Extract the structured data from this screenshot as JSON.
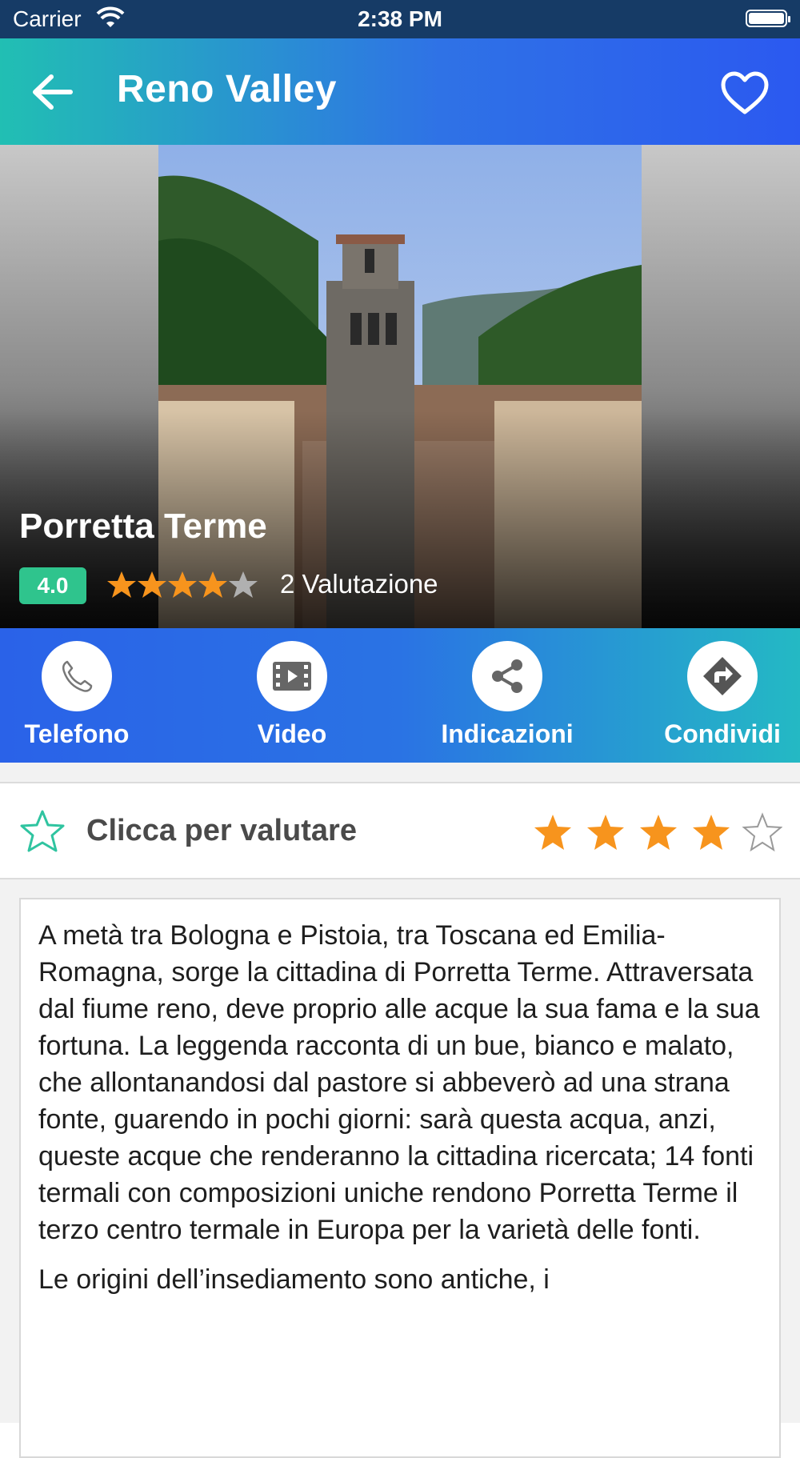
{
  "status_bar": {
    "carrier": "Carrier",
    "time": "2:38 PM"
  },
  "app_bar": {
    "title": "Reno Valley"
  },
  "place": {
    "name": "Porretta Terme",
    "rating_badge": "4.0",
    "rating_value": 4,
    "rating_max": 5,
    "ratings_count_text": "2 Valutazione"
  },
  "actions": [
    {
      "label": "Telefono",
      "icon": "phone-icon"
    },
    {
      "label": "Video",
      "icon": "video-icon"
    },
    {
      "label": "Indicazioni",
      "icon": "share-icon"
    },
    {
      "label": "Condividi",
      "icon": "directions-icon"
    }
  ],
  "rate_section": {
    "label": "Clicca per valutare",
    "user_rating": 4,
    "max": 5
  },
  "description": {
    "paragraphs": [
      "A metà tra Bologna e Pistoia, tra Toscana ed Emilia-Romagna, sorge la cittadina di Porretta Terme. Attraversata dal fiume reno, deve proprio alle acque la sua fama e la sua fortuna. La leggenda racconta di un bue, bianco e malato, che allontanandosi dal pastore si abbeverò ad una strana fonte, guarendo in pochi giorni: sarà questa acqua, anzi, queste acque che renderanno la cittadina ricercata; 14 fonti termali con composizioni uniche rendono Porretta Terme il terzo centro termale in Europa per la varietà delle fonti.",
      "Le origini dell’insediamento sono antiche, i"
    ]
  },
  "colors": {
    "accent_teal": "#21bfb3",
    "accent_blue": "#2b59f0",
    "star_orange": "#f7941d",
    "badge_green": "#2fc48d"
  }
}
